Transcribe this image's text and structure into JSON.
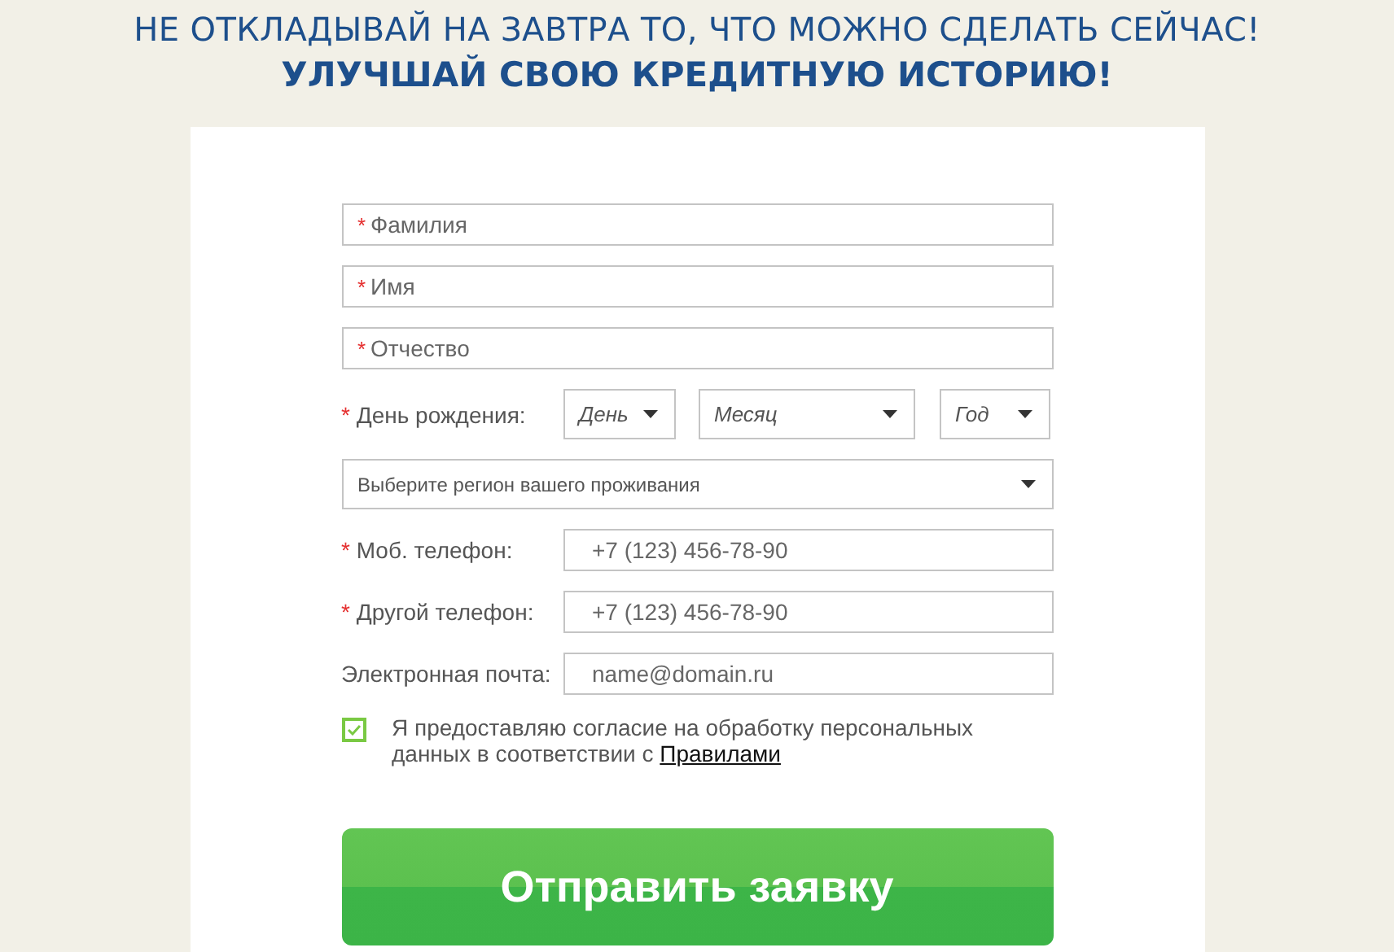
{
  "headline": "НЕ ОТКЛАДЫВАЙ НА ЗАВТРА ТО, ЧТО МОЖНО СДЕЛАТЬ СЕЙЧАС!",
  "subheadline": "УЛУЧШАЙ СВОЮ КРЕДИТНУЮ ИСТОРИЮ!",
  "name_fields": [
    {
      "placeholder": "Фамилия",
      "required_mark": "*"
    },
    {
      "placeholder": "Имя",
      "required_mark": "*"
    },
    {
      "placeholder": "Отчество",
      "required_mark": "*"
    }
  ],
  "birthday": {
    "label": "День рождения:",
    "required_mark": "*",
    "selects": [
      "День",
      "Месяц",
      "Год"
    ]
  },
  "region_select": "Выберите регион вашего проживания",
  "contact_fields": [
    {
      "label": "Моб. телефон:",
      "required_mark": "*",
      "placeholder": "+7 (123) 456-78-90"
    },
    {
      "label": "Другой телефон:",
      "required_mark": "*",
      "placeholder": "+7 (123) 456-78-90"
    },
    {
      "label": "Электронная почта:",
      "placeholder": "name@domain.ru"
    }
  ],
  "consent": {
    "checked": true,
    "text": "Я предоставляю согласие на обработку персональных данных в соответствии с ",
    "link": "Правилами"
  },
  "submit": "Отправить заявку"
}
